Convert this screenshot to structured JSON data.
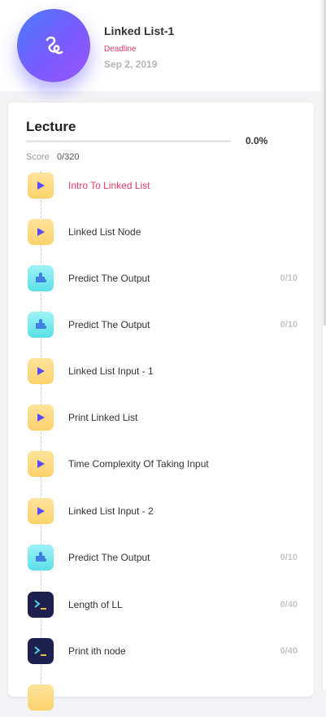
{
  "course": {
    "title": "Linked List-1",
    "deadline_label": "Deadline",
    "deadline_date": "Sep 2, 2019"
  },
  "lecture": {
    "title": "Lecture",
    "progress_fraction": 0.0,
    "progress_text": "0.0%",
    "score_label": "Score",
    "score_value": "0/320"
  },
  "items": [
    {
      "label": "Intro To Linked List",
      "type": "video",
      "score": "",
      "active": true
    },
    {
      "label": "Linked List Node",
      "type": "video",
      "score": "",
      "active": false
    },
    {
      "label": "Predict The Output",
      "type": "puzzle",
      "score": "0/10",
      "active": false
    },
    {
      "label": "Predict The Output",
      "type": "puzzle",
      "score": "0/10",
      "active": false
    },
    {
      "label": "Linked List Input - 1",
      "type": "video",
      "score": "",
      "active": false
    },
    {
      "label": "Print Linked List",
      "type": "video",
      "score": "",
      "active": false
    },
    {
      "label": "Time Complexity Of Taking Input",
      "type": "video",
      "score": "",
      "active": false
    },
    {
      "label": "Linked List Input - 2",
      "type": "video",
      "score": "",
      "active": false
    },
    {
      "label": "Predict The Output",
      "type": "puzzle",
      "score": "0/10",
      "active": false
    },
    {
      "label": "Length of LL",
      "type": "code",
      "score": "0/40",
      "active": false
    },
    {
      "label": "Print ith node",
      "type": "code",
      "score": "0/40",
      "active": false
    },
    {
      "label": "",
      "type": "video",
      "score": "",
      "active": false
    }
  ],
  "colors": {
    "accent": "#e5386b",
    "brand_gradient_start": "#4b7bff",
    "brand_gradient_end": "#9a55ff",
    "video_icon_bg": "#fcd26d",
    "puzzle_icon_bg": "#5cdfe8",
    "code_icon_bg": "#1e2150"
  },
  "icons": {
    "course": "linked-list-logo-icon",
    "video": "play-icon",
    "puzzle": "puzzle-icon",
    "code": "terminal-icon"
  }
}
